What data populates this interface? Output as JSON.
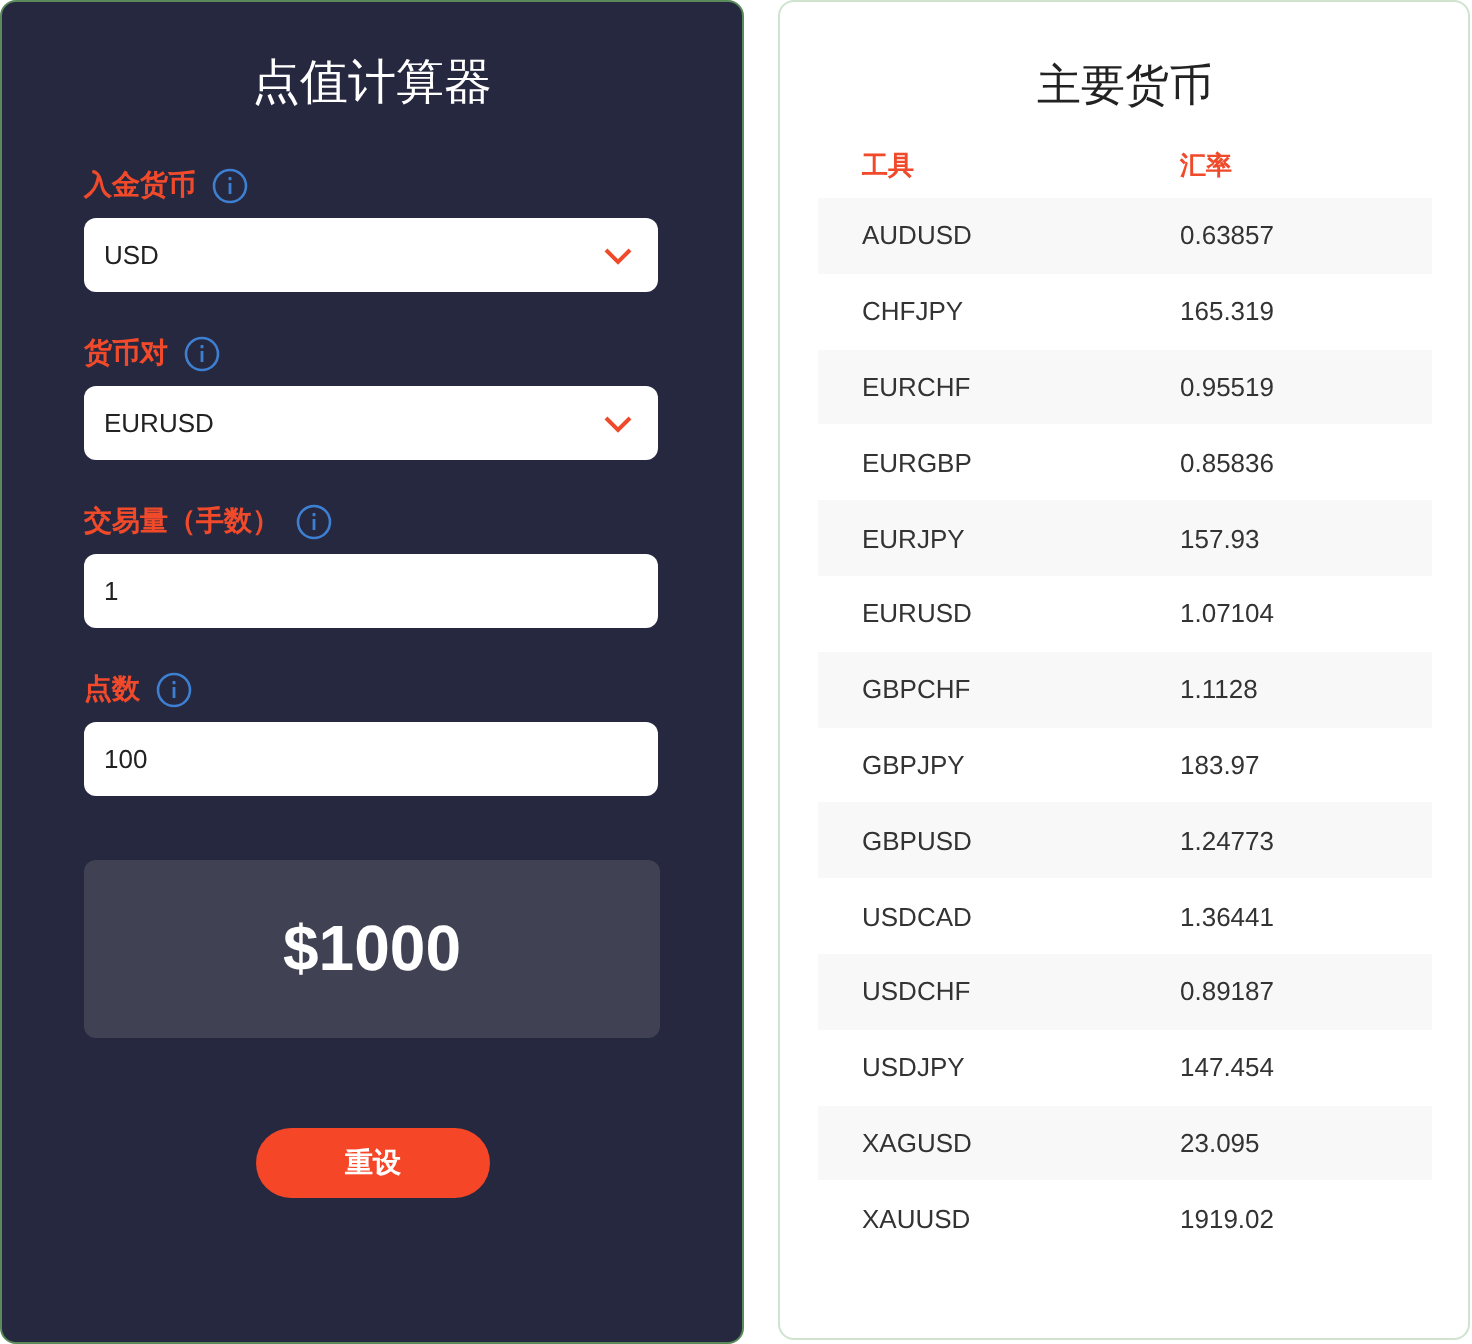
{
  "calculator": {
    "title": "点值计算器",
    "fields": [
      {
        "label": "入金货币",
        "kind": "select",
        "value": "USD"
      },
      {
        "label": "货币对",
        "kind": "select",
        "value": "EURUSD"
      },
      {
        "label": "交易量（手数）",
        "kind": "input",
        "value": "1"
      },
      {
        "label": "点数",
        "kind": "input",
        "value": "100"
      }
    ],
    "result": "$1000",
    "button": "重设"
  },
  "majors": {
    "title": "主要货币",
    "columns": [
      "工具",
      "汇率"
    ],
    "rows": [
      [
        "AUDUSD",
        "0.63857"
      ],
      [
        "CHFJPY",
        "165.319"
      ],
      [
        "EURCHF",
        "0.95519"
      ],
      [
        "EURGBP",
        "0.85836"
      ],
      [
        "EURJPY",
        "157.93"
      ],
      [
        "EURUSD",
        "1.07104"
      ],
      [
        "GBPCHF",
        "1.1128"
      ],
      [
        "GBPJPY",
        "183.97"
      ],
      [
        "GBPUSD",
        "1.24773"
      ],
      [
        "USDCAD",
        "1.36441"
      ],
      [
        "USDCHF",
        "0.89187"
      ],
      [
        "USDJPY",
        "147.454"
      ],
      [
        "XAGUSD",
        "23.095"
      ],
      [
        "XAUUSD",
        "1919.02"
      ]
    ]
  }
}
